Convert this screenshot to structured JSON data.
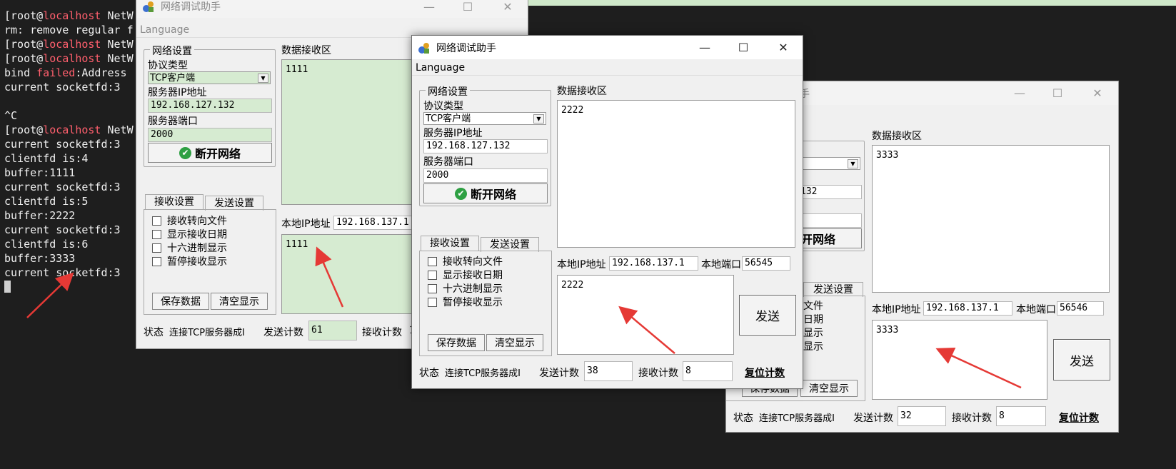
{
  "terminal": {
    "lines": [
      {
        "a": "[root@",
        "h": "localhost",
        "b": " NetW"
      },
      {
        "a": "rm: remove regular f"
      },
      {
        "a": "[root@",
        "h": "localhost",
        "b": " NetW"
      },
      {
        "a": "[root@",
        "h": "localhost",
        "b": " NetW"
      },
      {
        "a": "bind ",
        "f": "failed",
        "b": ":Address"
      },
      {
        "a": "current socketfd:3"
      },
      {
        "a": ""
      },
      {
        "a": "^C"
      },
      {
        "a": "[root@",
        "h": "localhost",
        "b": " NetW"
      },
      {
        "a": "current socketfd:3"
      },
      {
        "a": "clientfd is:4"
      },
      {
        "a": "buffer:1111"
      },
      {
        "a": "current socketfd:3"
      },
      {
        "a": "clientfd is:5"
      },
      {
        "a": "buffer:2222"
      },
      {
        "a": "current socketfd:3"
      },
      {
        "a": "clientfd is:6"
      },
      {
        "a": "buffer:3333"
      },
      {
        "a": "current socketfd:3"
      }
    ]
  },
  "labels": {
    "app_title": "网络调试助手",
    "app_title_partial": "手",
    "menu_language": "Language",
    "net_settings": "网络设置",
    "protocol": "协议类型",
    "protocol_value": "TCP客户端",
    "server_ip": "服务器IP地址",
    "server_ip_value": "192.168.127.132",
    "server_ip_partial": "132",
    "server_port": "服务器端口",
    "server_port_value": "2000",
    "disconnect": "断开网络",
    "disconnect_partial": "开网络",
    "recv_area": "数据接收区",
    "recv_settings": "接收设置",
    "send_settings": "发送设置",
    "chk_redirect": "接收转向文件",
    "chk_date": "显示接收日期",
    "chk_hex": "十六进制显示",
    "chk_pause": "暂停接收显示",
    "save_data": "保存数据",
    "save_data_partial": "保存数据",
    "clear_display": "清空显示",
    "local_ip": "本地IP地址",
    "local_port": "本地端口",
    "send": "发送",
    "status": "状态",
    "status_value": "连接TCP服务器成I",
    "send_count": "发送计数",
    "recv_count": "接收计数",
    "reset_count": "复位计数",
    "partial_chk_1": "文件",
    "partial_chk_2": "日期",
    "partial_chk_3": "显示",
    "partial_chk_4": "显示"
  },
  "window1": {
    "recv_text": "1111",
    "local_ip": "192.168.137.1",
    "send_text": "1111",
    "send_count": "61",
    "recv_count_partial": "1"
  },
  "window2": {
    "recv_text": "2222",
    "local_ip": "192.168.137.1",
    "local_port": "56545",
    "send_text": "2222",
    "send_count": "38",
    "recv_count": "8"
  },
  "window3": {
    "recv_text": "3333",
    "local_ip": "192.168.137.1",
    "local_port": "56546",
    "send_text": "3333",
    "send_count": "32",
    "recv_count": "8"
  },
  "colors": {
    "arrow": "#e53935",
    "green_field": "#d6ebd1",
    "terminal_bg": "#1e1e1e",
    "terminal_highlight": "#ff5f6d"
  }
}
